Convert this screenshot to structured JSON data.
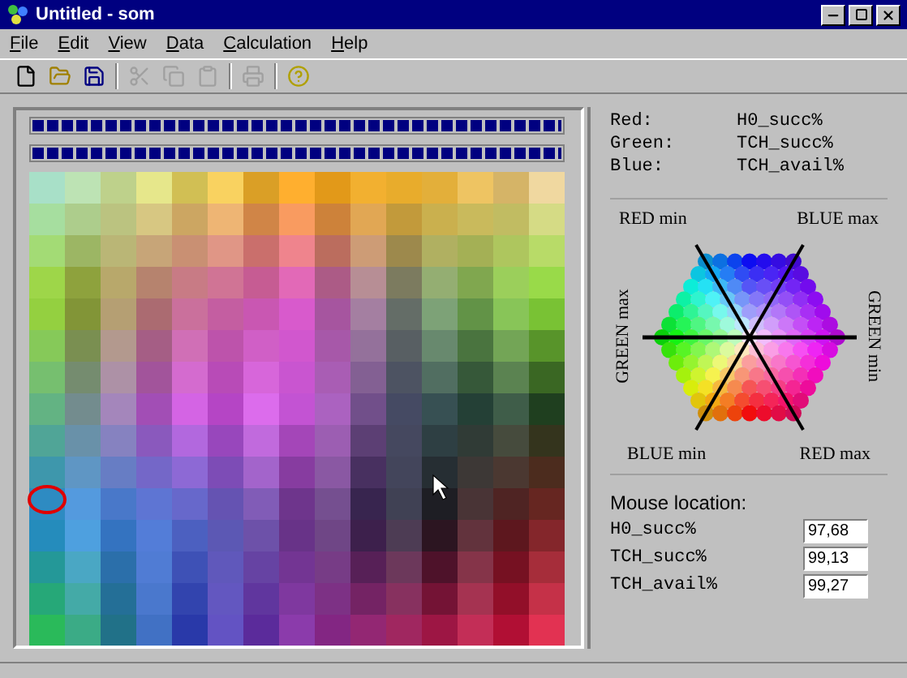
{
  "window": {
    "title": "Untitled - som"
  },
  "menu": [
    {
      "label": "File"
    },
    {
      "label": "Edit"
    },
    {
      "label": "View"
    },
    {
      "label": "Data"
    },
    {
      "label": "Calculation"
    },
    {
      "label": "Help"
    }
  ],
  "toolbar": [
    {
      "kind": "new",
      "disabled": false
    },
    {
      "kind": "open",
      "disabled": false
    },
    {
      "kind": "save",
      "disabled": false
    },
    {
      "kind": "cut",
      "disabled": true
    },
    {
      "kind": "copy",
      "disabled": true
    },
    {
      "kind": "paste",
      "disabled": true
    },
    {
      "kind": "print",
      "disabled": true
    },
    {
      "kind": "help",
      "disabled": false
    }
  ],
  "progress_bars": [
    {
      "level": 1
    },
    {
      "level": 1
    }
  ],
  "legend": [
    {
      "label": "Red:",
      "value": "H0_succ%"
    },
    {
      "label": "Green:",
      "value": "TCH_succ%"
    },
    {
      "label": "Blue:",
      "value": "TCH_avail%"
    }
  ],
  "color_wheel": {
    "top_left": "RED min",
    "top_right": "BLUE max",
    "left": "GREEN max",
    "right": "GREEN min",
    "bottom_left": "BLUE min",
    "bottom_right": "RED max"
  },
  "mouse_location": {
    "title": "Mouse location:",
    "rows": [
      {
        "label": "H0_succ%",
        "value": "97,68"
      },
      {
        "label": "TCH_succ%",
        "value": "99,13"
      },
      {
        "label": "TCH_avail%",
        "value": "99,27"
      }
    ]
  }
}
